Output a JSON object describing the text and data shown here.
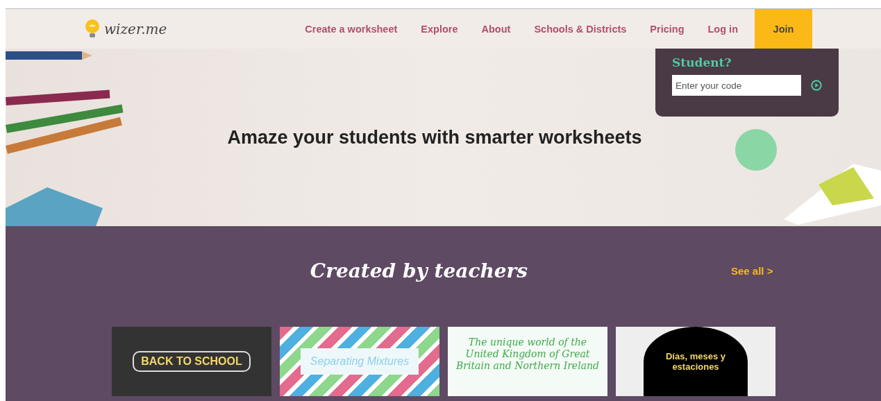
{
  "header": {
    "logo": "wizer.me",
    "nav": [
      {
        "label": "Create a worksheet",
        "kind": "link"
      },
      {
        "label": "Explore",
        "kind": "link"
      },
      {
        "label": "About",
        "kind": "link"
      },
      {
        "label": "Schools & Districts",
        "kind": "link"
      },
      {
        "label": "Pricing",
        "kind": "link"
      },
      {
        "label": "Log in",
        "kind": "link"
      },
      {
        "label": "Join",
        "kind": "button"
      }
    ]
  },
  "student_panel": {
    "title": "Student?",
    "placeholder": "Enter your code"
  },
  "hero": {
    "headline": "Amaze your students with smarter worksheets"
  },
  "gallery": {
    "title": "Created by teachers",
    "see_all": "See all >",
    "cards": [
      {
        "cover_text": "BACK TO SCHOOL",
        "kind": "chalkboard"
      },
      {
        "cover_text": "Separating Mixtures",
        "kind": "chevron"
      },
      {
        "cover_text": "The unique world of the United Kingdom of Great Britain and Northern Ireland",
        "kind": "grid"
      },
      {
        "cover_text": "Días, meses y estaciones",
        "kind": "circle"
      }
    ]
  }
}
